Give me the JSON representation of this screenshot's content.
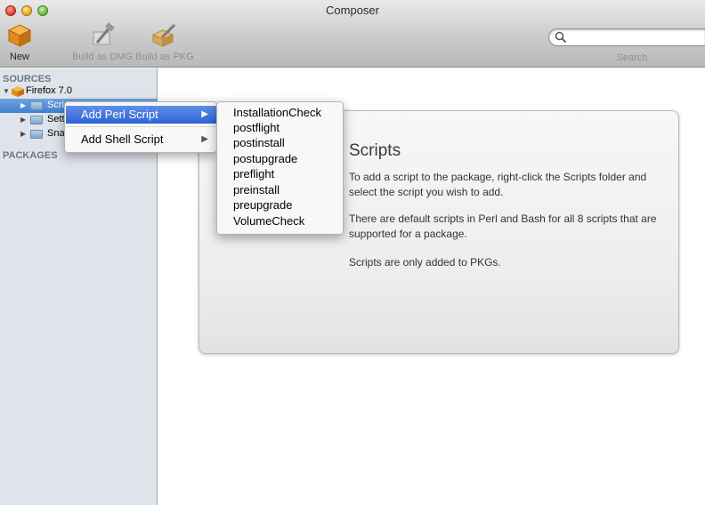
{
  "window": {
    "title": "Composer"
  },
  "toolbar": {
    "new_label": "New",
    "build_dmg_label": "Build as DMG",
    "build_pkg_label": "Build as PKG",
    "search_label": "Search",
    "search_value": ""
  },
  "sidebar": {
    "sources_header": "SOURCES",
    "source_name": "Firefox 7.0",
    "children": [
      "Scripts",
      "Settings",
      "Snapshot"
    ],
    "children_visible": [
      "Scri",
      "Sett",
      "Sna"
    ],
    "packages_header": "PACKAGES"
  },
  "content": {
    "title": "Scripts",
    "para1": "To add a script to the package, right-click the Scripts folder and select the script you wish to add.",
    "para2": "There are default scripts in Perl and Bash for all 8 scripts that are supported for a package.",
    "para3": "Scripts are only added to PKGs."
  },
  "context_menu": {
    "items": [
      {
        "label": "Add Perl Script",
        "highlighted": true
      },
      {
        "label": "Add Shell Script",
        "highlighted": false
      }
    ],
    "submenu": [
      "InstallationCheck",
      "postflight",
      "postinstall",
      "postupgrade",
      "preflight",
      "preinstall",
      "preupgrade",
      "VolumeCheck"
    ]
  },
  "colors": {
    "selection": "#3f7fd0",
    "menu_highlight": "#2e63d6",
    "sidebar_bg": "#dee4ea"
  }
}
